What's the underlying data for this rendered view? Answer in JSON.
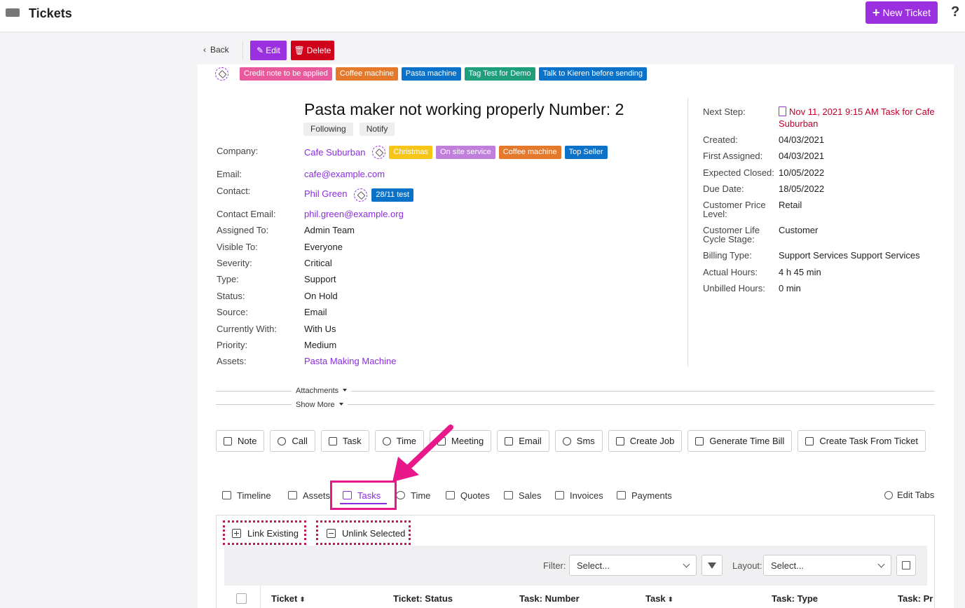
{
  "topbar": {
    "title": "Tickets",
    "new_ticket": "New Ticket",
    "help": "?"
  },
  "toolbar": {
    "back": "Back",
    "edit": "Edit",
    "delete": "Delete"
  },
  "ticket_tags": [
    {
      "label": "Credit note to be applied",
      "color": "#e85a9c"
    },
    {
      "label": "Coffee machine",
      "color": "#e4792b"
    },
    {
      "label": "Pasta machine",
      "color": "#0b72c9"
    },
    {
      "label": "Tag Test for Demo",
      "color": "#1e9e7a"
    },
    {
      "label": "Talk to Kieren before sending",
      "color": "#0b72c9"
    }
  ],
  "ticket": {
    "title": "Pasta maker not working properly Number: 2",
    "following": "Following",
    "notify": "Notify"
  },
  "fields": {
    "company_label": "Company:",
    "company": "Cafe Suburban",
    "company_tags": [
      {
        "label": "Christmas",
        "color": "#f5c518"
      },
      {
        "label": "On site service",
        "color": "#c17fdc"
      },
      {
        "label": "Coffee machine",
        "color": "#e4792b"
      },
      {
        "label": "Top Seller",
        "color": "#0b72c9"
      }
    ],
    "email_label": "Email:",
    "email": "cafe@example.com",
    "contact_label": "Contact:",
    "contact": "Phil Green",
    "contact_tag": {
      "label": "28/11 test",
      "color": "#0b72c9"
    },
    "contact_email_label": "Contact Email:",
    "contact_email": "phil.green@example.org",
    "assigned_label": "Assigned To:",
    "assigned": "Admin Team",
    "visible_label": "Visible To:",
    "visible": "Everyone",
    "severity_label": "Severity:",
    "severity": "Critical",
    "type_label": "Type:",
    "type": "Support",
    "status_label": "Status:",
    "status": "On Hold",
    "source_label": "Source:",
    "source": "Email",
    "with_label": "Currently With:",
    "with": "With Us",
    "priority_label": "Priority:",
    "priority": "Medium",
    "assets_label": "Assets:",
    "assets": "Pasta Making Machine"
  },
  "right": {
    "next_step_label": "Next Step:",
    "next_step_line1": "Nov 11, 2021 9:15 AM Task for Cafe",
    "next_step_line2": "Suburban",
    "created_label": "Created:",
    "created": "04/03/2021",
    "first_assigned_label": "First Assigned:",
    "first_assigned": "04/03/2021",
    "expected_closed_label": "Expected Closed:",
    "expected_closed": "10/05/2022",
    "due_date_label": "Due Date:",
    "due_date": "18/05/2022",
    "price_level_label1": "Customer Price",
    "price_level_label2": "Level:",
    "price_level": "Retail",
    "life_cycle_label1": "Customer Life",
    "life_cycle_label2": "Cycle Stage:",
    "life_cycle": "Customer",
    "billing_type_label": "Billing Type:",
    "billing_type": "Support Services Support Services",
    "actual_hours_label": "Actual Hours:",
    "actual_hours": "4 h 45 min",
    "unbilled_hours_label": "Unbilled Hours:",
    "unbilled_hours": "0 min"
  },
  "sections": {
    "attachments": "Attachments",
    "show_more": "Show More"
  },
  "actions": [
    "Note",
    "Call",
    "Task",
    "Time",
    "Meeting",
    "Email",
    "Sms",
    "Create Job",
    "Generate Time Bill",
    "Create Task From Ticket"
  ],
  "tabs": [
    "Timeline",
    "Assets",
    "Tasks",
    "Time",
    "Quotes",
    "Sales",
    "Invoices",
    "Payments"
  ],
  "active_tab": "Tasks",
  "edit_tabs": "Edit Tabs",
  "panel": {
    "link_existing": "Link Existing",
    "unlink_selected": "Unlink Selected",
    "filter_label": "Filter:",
    "filter_placeholder": "Select...",
    "layout_label": "Layout:",
    "layout_placeholder": "Select..."
  },
  "table": {
    "columns": [
      "Ticket",
      "Ticket: Status",
      "Task: Number",
      "Task",
      "Task: Type",
      "Task: Pr"
    ]
  },
  "colors": {
    "accent": "#9b30e0",
    "danger": "#d0021b",
    "annotation": "#e8178a"
  }
}
